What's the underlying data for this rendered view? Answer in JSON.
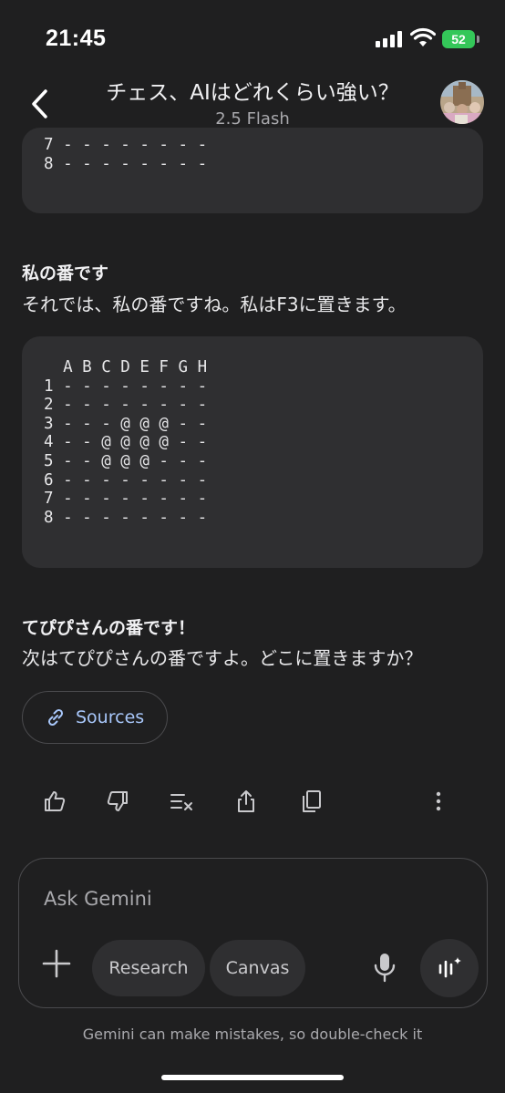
{
  "status_bar": {
    "time": "21:45",
    "battery": "52"
  },
  "header": {
    "title": "チェス、AIはどれくらい強い？",
    "model": "2.5 Flash"
  },
  "board_partial": "7 - - - - - - - -\n8 - - - - - - - -",
  "section1": {
    "heading": "私の番です",
    "text": "それでは、私の番ですね。私はF3に置きます。"
  },
  "board": "  A B C D E F G H\n1 - - - - - - - -\n2 - - - - - - - -\n3 - - - @ @ @ - -\n4 - - @ @ @ @ - -\n5 - - @ @ @ - - -\n6 - - - - - - - -\n7 - - - - - - - -\n8 - - - - - - - -",
  "section2": {
    "heading": "てぴぴさんの番です！",
    "text": "次はてぴぴさんの番ですよ。どこに置きますか？"
  },
  "sources_label": "Sources",
  "icons": [
    "thumb-up-icon",
    "thumb-down-icon",
    "double-check-icon",
    "share-icon",
    "copy-icon",
    "more-vert-icon"
  ],
  "input": {
    "placeholder": "Ask Gemini",
    "chips": [
      "Research",
      "Canvas"
    ]
  },
  "disclaimer": "Gemini can make mistakes, so double-check it",
  "colors": {
    "background": "#1f1f20",
    "surface": "#2f2f31",
    "link": "#a8c7fa",
    "battery": "#34c759"
  }
}
